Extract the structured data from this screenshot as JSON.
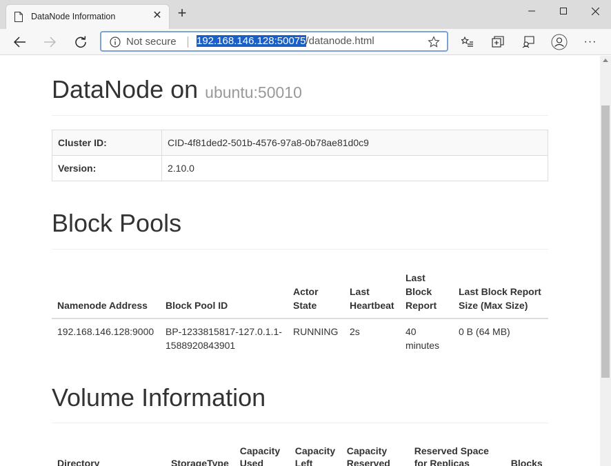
{
  "browser": {
    "tab_title": "DataNode Information",
    "new_tab_symbol": "+",
    "close_symbol": "✕",
    "address": {
      "security_label": "Not secure",
      "host": "192.168.146.128:50075",
      "path": "/datanode.html"
    },
    "more_symbol": "···"
  },
  "page": {
    "title": "DataNode on",
    "subtitle": "ubuntu:50010",
    "info": [
      {
        "key": "Cluster ID:",
        "value": "CID-4f81ded2-501b-4576-97a8-0b78ae81d0c9"
      },
      {
        "key": "Version:",
        "value": "2.10.0"
      }
    ],
    "block_pools": {
      "heading": "Block Pools",
      "columns": [
        "Namenode Address",
        "Block Pool ID",
        "Actor State",
        "Last Heartbeat",
        "Last Block Report",
        "Last Block Report Size (Max Size)"
      ],
      "rows": [
        {
          "namenode": "192.168.146.128:9000",
          "pool_id": "BP-1233815817-127.0.1.1-1588920843901",
          "state": "RUNNING",
          "heartbeat": "2s",
          "report": "40 minutes",
          "size": "0 B (64 MB)"
        }
      ]
    },
    "volumes": {
      "heading": "Volume Information",
      "columns": [
        "Directory",
        "StorageType",
        "Capacity Used",
        "Capacity Left",
        "Capacity Reserved",
        "Reserved Space for Replicas",
        "Blocks"
      ]
    }
  }
}
